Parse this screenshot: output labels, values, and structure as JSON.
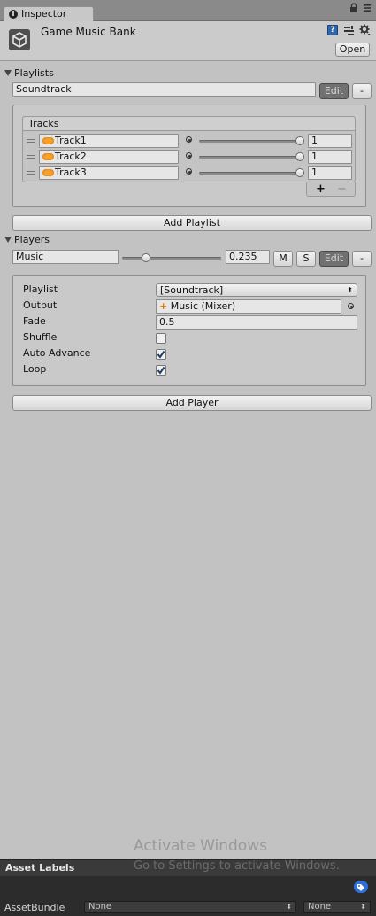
{
  "tab": {
    "label": "Inspector",
    "icon": "info-icon"
  },
  "header": {
    "title": "Game Music Bank",
    "open_label": "Open"
  },
  "playlists": {
    "section_label": "Playlists",
    "name_value": "Soundtrack",
    "edit_label": "Edit",
    "remove_label": "-",
    "tracks_header": "Tracks",
    "tracks": [
      {
        "name": "Track1",
        "volume": 1,
        "volume_text": "1"
      },
      {
        "name": "Track2",
        "volume": 1,
        "volume_text": "1"
      },
      {
        "name": "Track3",
        "volume": 1,
        "volume_text": "1"
      }
    ],
    "add_label": "+",
    "remove_track_label": "−",
    "add_playlist_label": "Add Playlist"
  },
  "players": {
    "section_label": "Players",
    "name_value": "Music",
    "volume": 0.235,
    "volume_text": "0.235",
    "mute_label": "M",
    "solo_label": "S",
    "edit_label": "Edit",
    "remove_label": "-",
    "properties": {
      "playlist_label": "Playlist",
      "playlist_value": "[Soundtrack]",
      "output_label": "Output",
      "output_value": "Music (Mixer)",
      "fade_label": "Fade",
      "fade_value": "0.5",
      "shuffle_label": "Shuffle",
      "shuffle_checked": false,
      "auto_advance_label": "Auto Advance",
      "auto_advance_checked": true,
      "loop_label": "Loop",
      "loop_checked": true
    },
    "add_player_label": "Add Player"
  },
  "watermark": {
    "line1": "Activate Windows",
    "line2": "Go to Settings to activate Windows."
  },
  "asset_labels": {
    "title": "Asset Labels",
    "assetbundle_label": "AssetBundle",
    "assetbundle_value": "None",
    "variant_value": "None"
  },
  "colors": {
    "edit_button_bg": "#717171",
    "accent_blue": "#2f6fd6",
    "audio_orange": "#f09020"
  }
}
